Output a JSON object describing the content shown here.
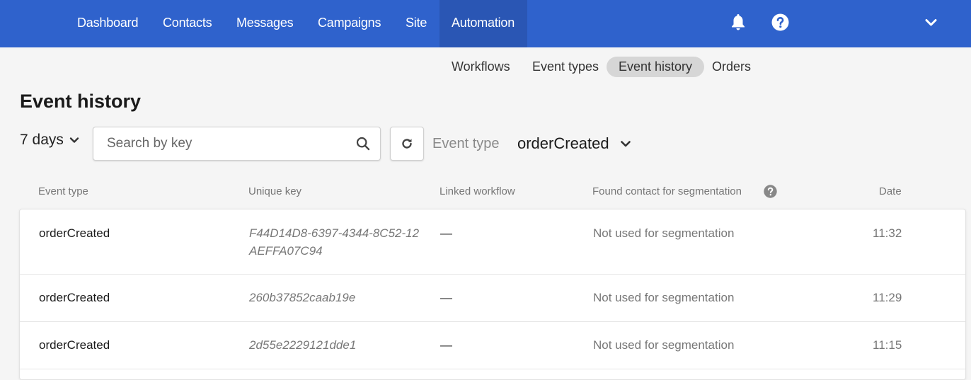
{
  "nav": {
    "items": [
      {
        "label": "Dashboard"
      },
      {
        "label": "Contacts"
      },
      {
        "label": "Messages"
      },
      {
        "label": "Campaigns"
      },
      {
        "label": "Site"
      },
      {
        "label": "Automation",
        "active": true
      }
    ],
    "icons": [
      "bell-icon",
      "help-icon",
      "chevron-down-icon"
    ],
    "background": "#2f62cc"
  },
  "subnav": {
    "items": [
      {
        "label": "Workflows"
      },
      {
        "label": "Event types"
      },
      {
        "label": "Event history",
        "active": true
      },
      {
        "label": "Orders"
      }
    ]
  },
  "page": {
    "title": "Event history"
  },
  "filters": {
    "period": "7 days",
    "search_placeholder": "Search by key",
    "event_type_label": "Event type",
    "event_type_value": "orderCreated"
  },
  "table": {
    "headers": [
      "Event type",
      "Unique key",
      "Linked workflow",
      "Found contact for segmentation",
      "Date"
    ],
    "rows": [
      {
        "type": "orderCreated",
        "key": "F44D14D8-6397-4344-8C52-12AEFFA07C94",
        "workflow": "—",
        "segmentation": "Not used for segmentation",
        "date": "11:32"
      },
      {
        "type": "orderCreated",
        "key": "260b37852caab19e",
        "workflow": "—",
        "segmentation": "Not used for segmentation",
        "date": "11:29"
      },
      {
        "type": "orderCreated",
        "key": "2d55e2229121dde1",
        "workflow": "—",
        "segmentation": "Not used for segmentation",
        "date": "11:15"
      }
    ]
  }
}
